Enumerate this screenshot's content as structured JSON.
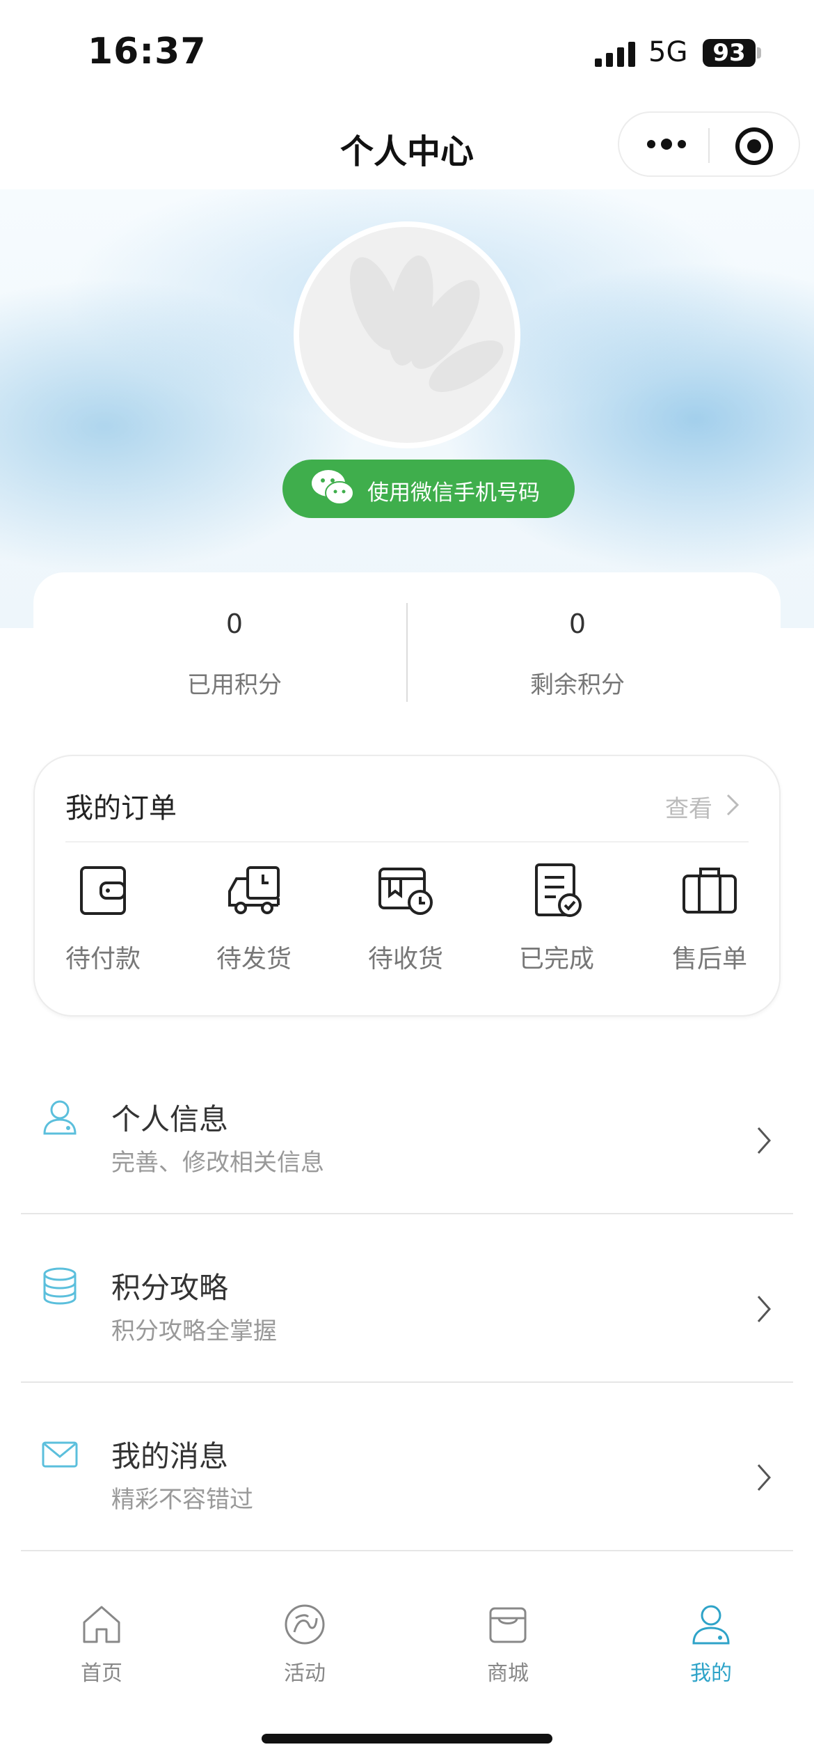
{
  "status_bar": {
    "time": "16:37",
    "network": "5G",
    "battery": "93"
  },
  "nav": {
    "title": "个人中心"
  },
  "profile": {
    "wechat_button_label": "使用微信手机号码"
  },
  "points": {
    "used": {
      "value": "0",
      "label": "已用积分"
    },
    "remaining": {
      "value": "0",
      "label": "剩余积分"
    }
  },
  "orders": {
    "title": "我的订单",
    "view_label": "查看",
    "items": [
      {
        "label": "待付款",
        "icon": "wallet-icon"
      },
      {
        "label": "待发货",
        "icon": "delivery-truck-icon"
      },
      {
        "label": "待收货",
        "icon": "package-clock-icon"
      },
      {
        "label": "已完成",
        "icon": "document-check-icon"
      },
      {
        "label": "售后单",
        "icon": "briefcase-icon"
      }
    ]
  },
  "menu": [
    {
      "title": "个人信息",
      "subtitle": "完善、修改相关信息",
      "icon": "user-icon"
    },
    {
      "title": "积分攻略",
      "subtitle": "积分攻略全掌握",
      "icon": "coins-icon"
    },
    {
      "title": "我的消息",
      "subtitle": "精彩不容错过",
      "icon": "mail-icon"
    }
  ],
  "tabbar": [
    {
      "label": "首页",
      "icon": "home-icon",
      "active": false
    },
    {
      "label": "活动",
      "icon": "activity-icon",
      "active": false
    },
    {
      "label": "商城",
      "icon": "shop-icon",
      "active": false
    },
    {
      "label": "我的",
      "icon": "profile-icon",
      "active": true
    }
  ],
  "colors": {
    "accent": "#2ea3c8",
    "wechat_green": "#3fae4c",
    "menu_icon": "#5bbfdc"
  }
}
